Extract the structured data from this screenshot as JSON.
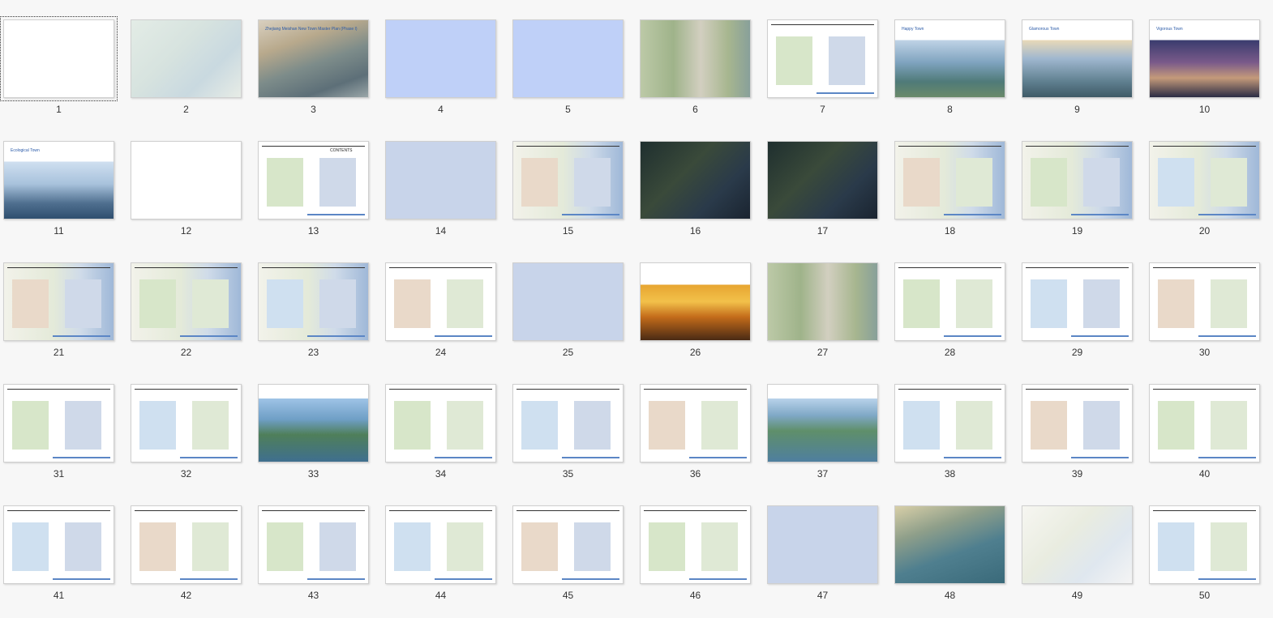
{
  "window": {
    "title": ""
  },
  "selected_slide": 1,
  "slides": [
    {
      "number": "1",
      "style": "t-blank"
    },
    {
      "number": "2",
      "style": "t-aerial-faded",
      "caption": ""
    },
    {
      "number": "3",
      "style": "t-aerial",
      "title": "Zhejiang Meishan New Town Master Plan (Phase I)"
    },
    {
      "number": "4",
      "style": "t-blue"
    },
    {
      "number": "5",
      "style": "t-blue"
    },
    {
      "number": "6",
      "style": "t-plan"
    },
    {
      "number": "7",
      "style": "t-page"
    },
    {
      "number": "8",
      "style": "t-sky1",
      "title": "Happy Town"
    },
    {
      "number": "9",
      "style": "t-sky2",
      "title": "Glamorous Town"
    },
    {
      "number": "10",
      "style": "t-sky3",
      "title": "Vigorous Town"
    },
    {
      "number": "11",
      "style": "t-sky4",
      "title": "Ecological Town"
    },
    {
      "number": "12",
      "style": "t-blank"
    },
    {
      "number": "13",
      "style": "t-page",
      "title": "CONTENTS"
    },
    {
      "number": "14",
      "style": "t-blue2"
    },
    {
      "number": "15",
      "style": "t-map"
    },
    {
      "number": "16",
      "style": "t-dark"
    },
    {
      "number": "17",
      "style": "t-dark"
    },
    {
      "number": "18",
      "style": "t-map"
    },
    {
      "number": "19",
      "style": "t-map"
    },
    {
      "number": "20",
      "style": "t-map"
    },
    {
      "number": "21",
      "style": "t-map"
    },
    {
      "number": "22",
      "style": "t-map"
    },
    {
      "number": "23",
      "style": "t-map"
    },
    {
      "number": "24",
      "style": "t-page"
    },
    {
      "number": "25",
      "style": "t-blue2"
    },
    {
      "number": "26",
      "style": "t-sunset"
    },
    {
      "number": "27",
      "style": "t-plan"
    },
    {
      "number": "28",
      "style": "t-page"
    },
    {
      "number": "29",
      "style": "t-page"
    },
    {
      "number": "30",
      "style": "t-page"
    },
    {
      "number": "31",
      "style": "t-page"
    },
    {
      "number": "32",
      "style": "t-page"
    },
    {
      "number": "33",
      "style": "t-lake"
    },
    {
      "number": "34",
      "style": "t-page"
    },
    {
      "number": "35",
      "style": "t-page"
    },
    {
      "number": "36",
      "style": "t-page"
    },
    {
      "number": "37",
      "style": "t-lake2"
    },
    {
      "number": "38",
      "style": "t-page"
    },
    {
      "number": "39",
      "style": "t-page"
    },
    {
      "number": "40",
      "style": "t-page"
    },
    {
      "number": "41",
      "style": "t-page"
    },
    {
      "number": "42",
      "style": "t-page"
    },
    {
      "number": "43",
      "style": "t-page"
    },
    {
      "number": "44",
      "style": "t-page"
    },
    {
      "number": "45",
      "style": "t-page"
    },
    {
      "number": "46",
      "style": "t-page"
    },
    {
      "number": "47",
      "style": "t-blue2"
    },
    {
      "number": "48",
      "style": "t-resort"
    },
    {
      "number": "49",
      "style": "t-iso"
    },
    {
      "number": "50",
      "style": "t-page"
    }
  ],
  "colors": {
    "background": "#f7f7f7",
    "slide_blue": "#bfd0f8",
    "accent_blue": "#2a5aa8"
  }
}
